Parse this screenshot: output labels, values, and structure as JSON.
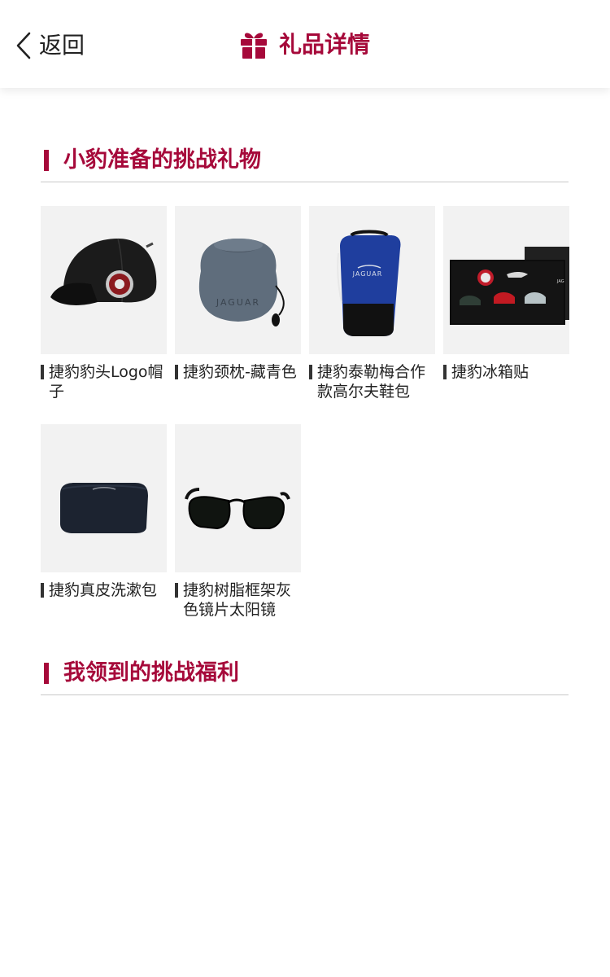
{
  "colors": {
    "accent": "#a6093a",
    "text": "#222222",
    "thumb_bg": "#f2f2f2"
  },
  "header": {
    "back_label": "返回",
    "back_icon": "chevron-left-icon",
    "title": "礼品详情",
    "title_icon": "gift-icon"
  },
  "sections": {
    "gifts_title": "小豹准备的挑战礼物",
    "benefits_title": "我领到的挑战福利"
  },
  "gifts": [
    {
      "name": "捷豹豹头Logo帽子",
      "image": "baseball-cap"
    },
    {
      "name": "捷豹颈枕-藏青色",
      "image": "neck-pillow-bag"
    },
    {
      "name": "捷豹泰勒梅合作款高尔夫鞋包",
      "image": "golf-shoe-bag"
    },
    {
      "name": "捷豹冰箱贴",
      "image": "fridge-magnet-set"
    },
    {
      "name": "捷豹真皮洗漱包",
      "image": "leather-wash-bag"
    },
    {
      "name": "捷豹树脂框架灰色镜片太阳镜",
      "image": "sunglasses"
    }
  ]
}
